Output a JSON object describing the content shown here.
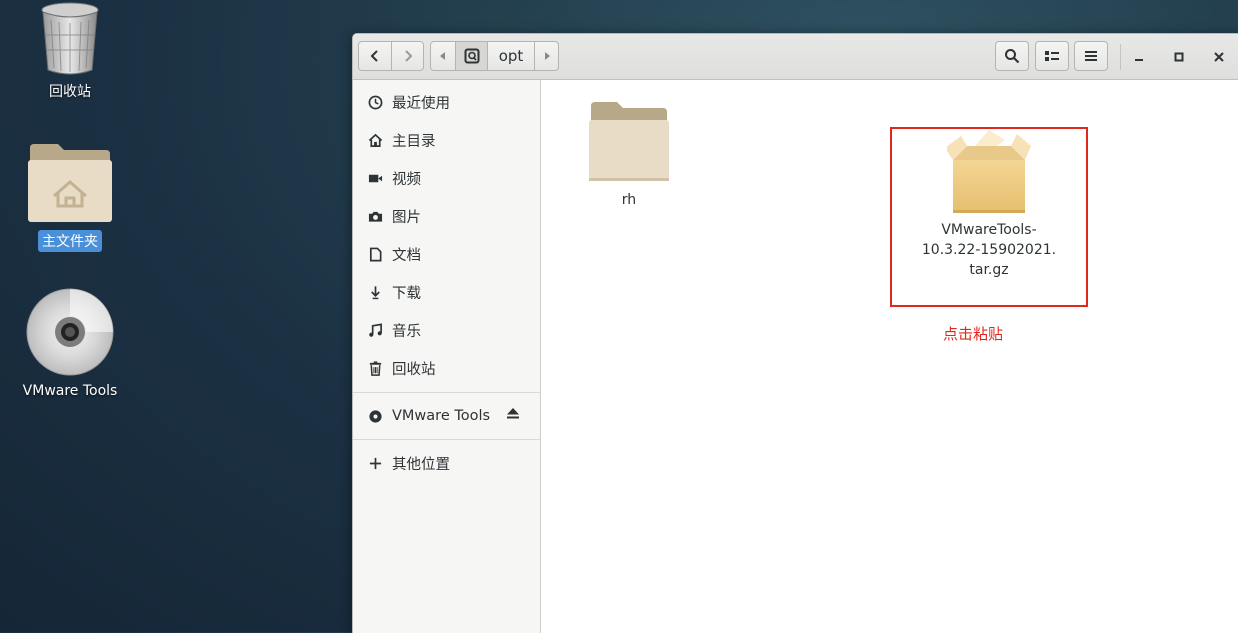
{
  "desktop": {
    "icons": [
      {
        "label": "回收站",
        "icon": "trash-icon"
      },
      {
        "label": "主文件夹",
        "icon": "home-folder-icon",
        "selected": true
      },
      {
        "label": "VMware Tools",
        "icon": "cd-disc-icon"
      }
    ]
  },
  "window": {
    "headerbar": {
      "back_icon": "chevron-left-icon",
      "forward_icon": "chevron-right-icon",
      "path": {
        "root_icon": "drive-icon",
        "current": "opt"
      },
      "actions": [
        "search-icon",
        "view-toggle-icon",
        "hamburger-menu-icon"
      ],
      "window_controls": [
        "minimize-icon",
        "maximize-icon",
        "close-icon"
      ]
    },
    "sidebar": {
      "items": [
        {
          "label": "最近使用",
          "icon": "clock-icon"
        },
        {
          "label": "主目录",
          "icon": "home-icon"
        },
        {
          "label": "视频",
          "icon": "video-icon"
        },
        {
          "label": "图片",
          "icon": "camera-icon"
        },
        {
          "label": "文档",
          "icon": "document-icon"
        },
        {
          "label": "下载",
          "icon": "download-icon"
        },
        {
          "label": "音乐",
          "icon": "music-icon"
        },
        {
          "label": "回收站",
          "icon": "trash-icon"
        }
      ],
      "devices": [
        {
          "label": "VMware Tools",
          "icon": "disc-icon",
          "action_icon": "eject-icon"
        }
      ],
      "other": {
        "label": "其他位置",
        "icon": "plus-icon"
      }
    },
    "content": {
      "files": [
        {
          "name": "rh",
          "type": "folder",
          "icon": "folder-icon"
        },
        {
          "name_lines": [
            "VMwareTools-",
            "10.3.22-15902021.",
            "tar.gz"
          ],
          "type": "archive",
          "icon": "package-box-icon"
        }
      ],
      "annotation": "点击粘贴",
      "annotation_color": "#e0281d"
    }
  }
}
